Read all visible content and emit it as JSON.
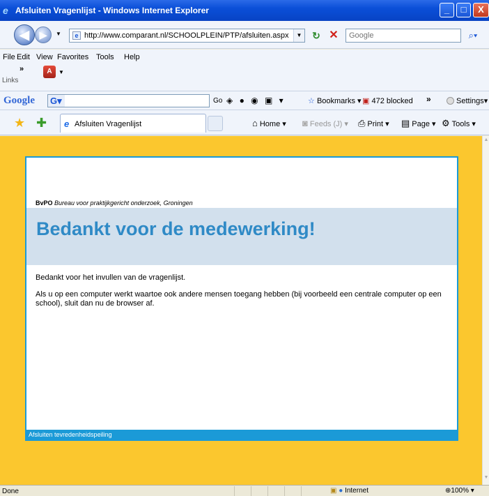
{
  "window": {
    "title": "Afsluiten Vragenlijst - Windows Internet Explorer",
    "minimize": "_",
    "maximize": "□",
    "close": "X"
  },
  "address_bar": {
    "url": "http://www.comparant.nl/SCHOOLPLEIN/PTP/afsluiten.aspx",
    "search_placeholder": "Google"
  },
  "menu": {
    "items": [
      "File",
      "Edit",
      "View",
      "Favorites",
      "Tools",
      "Help"
    ],
    "overflow": "»",
    "links_label": "Links"
  },
  "google_toolbar": {
    "logo": "Google",
    "g_button": "G",
    "go_label": "Go",
    "bookmarks_label": "Bookmarks",
    "blocked_label": "472 blocked",
    "more": "»",
    "settings_label": "Settings"
  },
  "tabs": {
    "active_label": "Afsluiten Vragenlijst",
    "home_label": "Home",
    "feeds_label": "Feeds (J)",
    "print_label": "Print",
    "page_label": "Page",
    "tools_label": "Tools"
  },
  "page": {
    "org_abbr": "BvPO",
    "org_name": "Bureau voor praktijkgericht onderzoek, Groningen",
    "heading": "Bedankt voor de medewerking!",
    "paragraph1": "Bedankt voor het invullen van de vragenlijst.",
    "paragraph2": "Als u op een computer werkt waartoe ook andere mensen toegang hebben (bij voorbeeld een centrale computer op een school), sluit dan nu de browser af.",
    "footer": "Afsluiten tevredenheidspeiling",
    "colors": {
      "background": "#fbc72e",
      "accent": "#1b9ad7",
      "banner": "#d2e0ed",
      "heading": "#2f8ac6"
    }
  },
  "status_bar": {
    "status": "Done",
    "zone": "Internet",
    "zoom": "100%"
  }
}
